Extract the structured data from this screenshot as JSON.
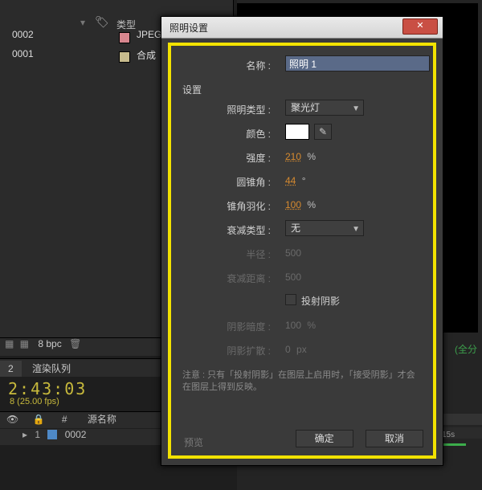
{
  "project": {
    "column_type_header": "类型",
    "rows": [
      {
        "name": "0002",
        "type": "JPEG"
      },
      {
        "name": "0001",
        "type": "合成"
      }
    ]
  },
  "footer": {
    "bpc": "8 bpc",
    "tabs": [
      "2",
      "渲染队列"
    ],
    "timecode_display": "2:43:03",
    "fps_display": "8 (25.00 fps)",
    "layer_cols": {
      "num": "#",
      "source": "源名称"
    },
    "layer_row": {
      "index": "1",
      "name": "0002"
    },
    "right_status": "(全分",
    "tick_15s": "15s"
  },
  "dialog": {
    "title": "照明设置",
    "name_label": "名称 :",
    "name_value": "照明 1",
    "section": "设置",
    "light_type": {
      "label": "照明类型 :",
      "value": "聚光灯"
    },
    "color_label": "颜色 :",
    "intensity": {
      "label": "强度 :",
      "value": "210",
      "unit": "%"
    },
    "cone_angle": {
      "label": "圆锥角 :",
      "value": "44",
      "unit": "°"
    },
    "cone_feather": {
      "label": "锥角羽化 :",
      "value": "100",
      "unit": "%"
    },
    "falloff_type": {
      "label": "衰减类型 :",
      "value": "无"
    },
    "radius": {
      "label": "半径 :",
      "value": "500"
    },
    "falloff_dist": {
      "label": "衰减距离 :",
      "value": "500"
    },
    "casts_shadows": "投射阴影",
    "shadow_darkness": {
      "label": "阴影暗度 :",
      "value": "100",
      "unit": "%"
    },
    "shadow_diffusion": {
      "label": "阴影扩散 :",
      "value": "0",
      "unit": "px"
    },
    "note": "注意 : 只有「投射阴影」在图层上启用时，「接受阴影」才会在图层上得到反映。",
    "preview": "预览",
    "ok": "确定",
    "cancel": "取消"
  }
}
